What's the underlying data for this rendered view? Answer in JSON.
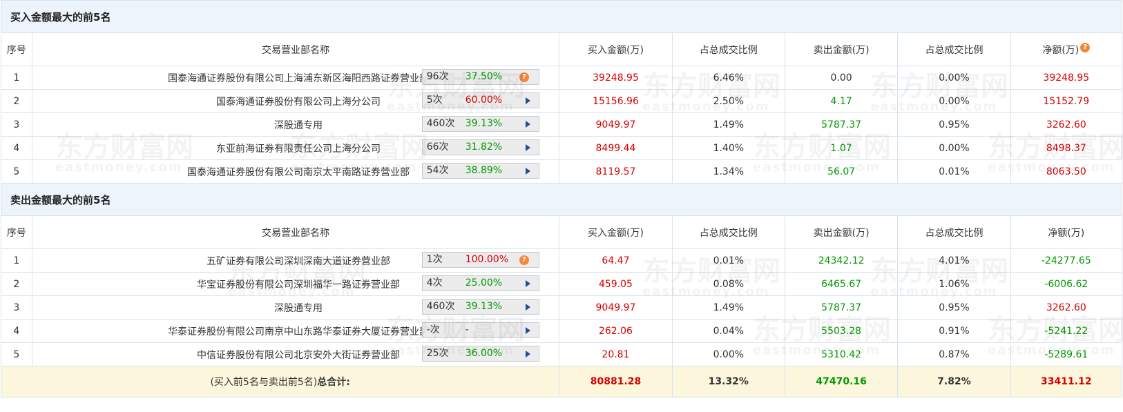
{
  "buy_section": {
    "title": "买入金额最大的前5名",
    "headers": [
      "序号",
      "交易营业部名称",
      "买入金额(万)",
      "占总成交比例",
      "卖出金额(万)",
      "占总成交比例",
      "净额(万)"
    ],
    "rows": [
      {
        "idx": "1",
        "name": "国泰海通证券股份有限公司上海浦东新区海阳西路证券营业部",
        "count": "96次",
        "pct": "37.50%",
        "pct_color": "green",
        "icon": "question",
        "buy": "39248.95",
        "buy_ratio": "6.46%",
        "sell": "0.00",
        "sell_ratio": "0.00%",
        "net": "39248.95",
        "sell_color": "black",
        "net_color": "red"
      },
      {
        "idx": "2",
        "name": "国泰海通证券股份有限公司上海分公司",
        "count": "5次",
        "pct": "60.00%",
        "pct_color": "red",
        "icon": "play",
        "buy": "15156.96",
        "buy_ratio": "2.50%",
        "sell": "4.17",
        "sell_ratio": "0.00%",
        "net": "15152.79",
        "sell_color": "green",
        "net_color": "red"
      },
      {
        "idx": "3",
        "name": "深股通专用",
        "count": "460次",
        "pct": "39.13%",
        "pct_color": "green",
        "icon": "play",
        "buy": "9049.97",
        "buy_ratio": "1.49%",
        "sell": "5787.37",
        "sell_ratio": "0.95%",
        "net": "3262.60",
        "sell_color": "green",
        "net_color": "red"
      },
      {
        "idx": "4",
        "name": "东亚前海证券有限责任公司上海分公司",
        "count": "66次",
        "pct": "31.82%",
        "pct_color": "green",
        "icon": "play",
        "buy": "8499.44",
        "buy_ratio": "1.40%",
        "sell": "1.07",
        "sell_ratio": "0.00%",
        "net": "8498.37",
        "sell_color": "green",
        "net_color": "red"
      },
      {
        "idx": "5",
        "name": "国泰海通证券股份有限公司南京太平南路证券营业部",
        "count": "54次",
        "pct": "38.89%",
        "pct_color": "green",
        "icon": "play",
        "buy": "8119.57",
        "buy_ratio": "1.34%",
        "sell": "56.07",
        "sell_ratio": "0.01%",
        "net": "8063.50",
        "sell_color": "green",
        "net_color": "red"
      }
    ]
  },
  "sell_section": {
    "title": "卖出金额最大的前5名",
    "headers": [
      "序号",
      "交易营业部名称",
      "买入金额(万)",
      "占总成交比例",
      "卖出金额(万)",
      "占总成交比例",
      "净额(万)"
    ],
    "rows": [
      {
        "idx": "1",
        "name": "五矿证券有限公司深圳深南大道证券营业部",
        "count": "1次",
        "pct": "100.00%",
        "pct_color": "red",
        "icon": "question",
        "buy": "64.47",
        "buy_ratio": "0.01%",
        "sell": "24342.12",
        "sell_ratio": "4.01%",
        "net": "-24277.65",
        "sell_color": "green",
        "net_color": "green"
      },
      {
        "idx": "2",
        "name": "华宝证券股份有限公司深圳福华一路证券营业部",
        "count": "4次",
        "pct": "25.00%",
        "pct_color": "green",
        "icon": "play",
        "buy": "459.05",
        "buy_ratio": "0.08%",
        "sell": "6465.67",
        "sell_ratio": "1.06%",
        "net": "-6006.62",
        "sell_color": "green",
        "net_color": "green"
      },
      {
        "idx": "3",
        "name": "深股通专用",
        "count": "460次",
        "pct": "39.13%",
        "pct_color": "green",
        "icon": "play",
        "buy": "9049.97",
        "buy_ratio": "1.49%",
        "sell": "5787.37",
        "sell_ratio": "0.95%",
        "net": "3262.60",
        "sell_color": "green",
        "net_color": "red"
      },
      {
        "idx": "4",
        "name": "华泰证券股份有限公司南京中山东路华泰证券大厦证券营业部",
        "count": "-次",
        "pct": "-",
        "pct_color": "black",
        "icon": "play",
        "buy": "262.06",
        "buy_ratio": "0.04%",
        "sell": "5503.28",
        "sell_ratio": "0.91%",
        "net": "-5241.22",
        "sell_color": "green",
        "net_color": "green"
      },
      {
        "idx": "5",
        "name": "中信证券股份有限公司北京安外大街证券营业部",
        "count": "25次",
        "pct": "36.00%",
        "pct_color": "green",
        "icon": "play",
        "buy": "20.81",
        "buy_ratio": "0.00%",
        "sell": "5310.42",
        "sell_ratio": "0.87%",
        "net": "-5289.61",
        "sell_color": "green",
        "net_color": "green"
      }
    ]
  },
  "total": {
    "label_prefix": "(买入前5名与卖出前5名)",
    "label_bold": "总合计:",
    "buy": "80881.28",
    "buy_ratio": "13.32%",
    "sell": "47470.16",
    "sell_ratio": "7.82%",
    "net": "33411.12"
  },
  "watermark": {
    "cn": "东方财富网",
    "en": "eastmoney.com"
  },
  "colors": {
    "red": "#d60000",
    "green": "#009900",
    "section_bg": "#edf4fb",
    "total_bg": "#fcf7dc",
    "border": "#d6e3ee"
  }
}
